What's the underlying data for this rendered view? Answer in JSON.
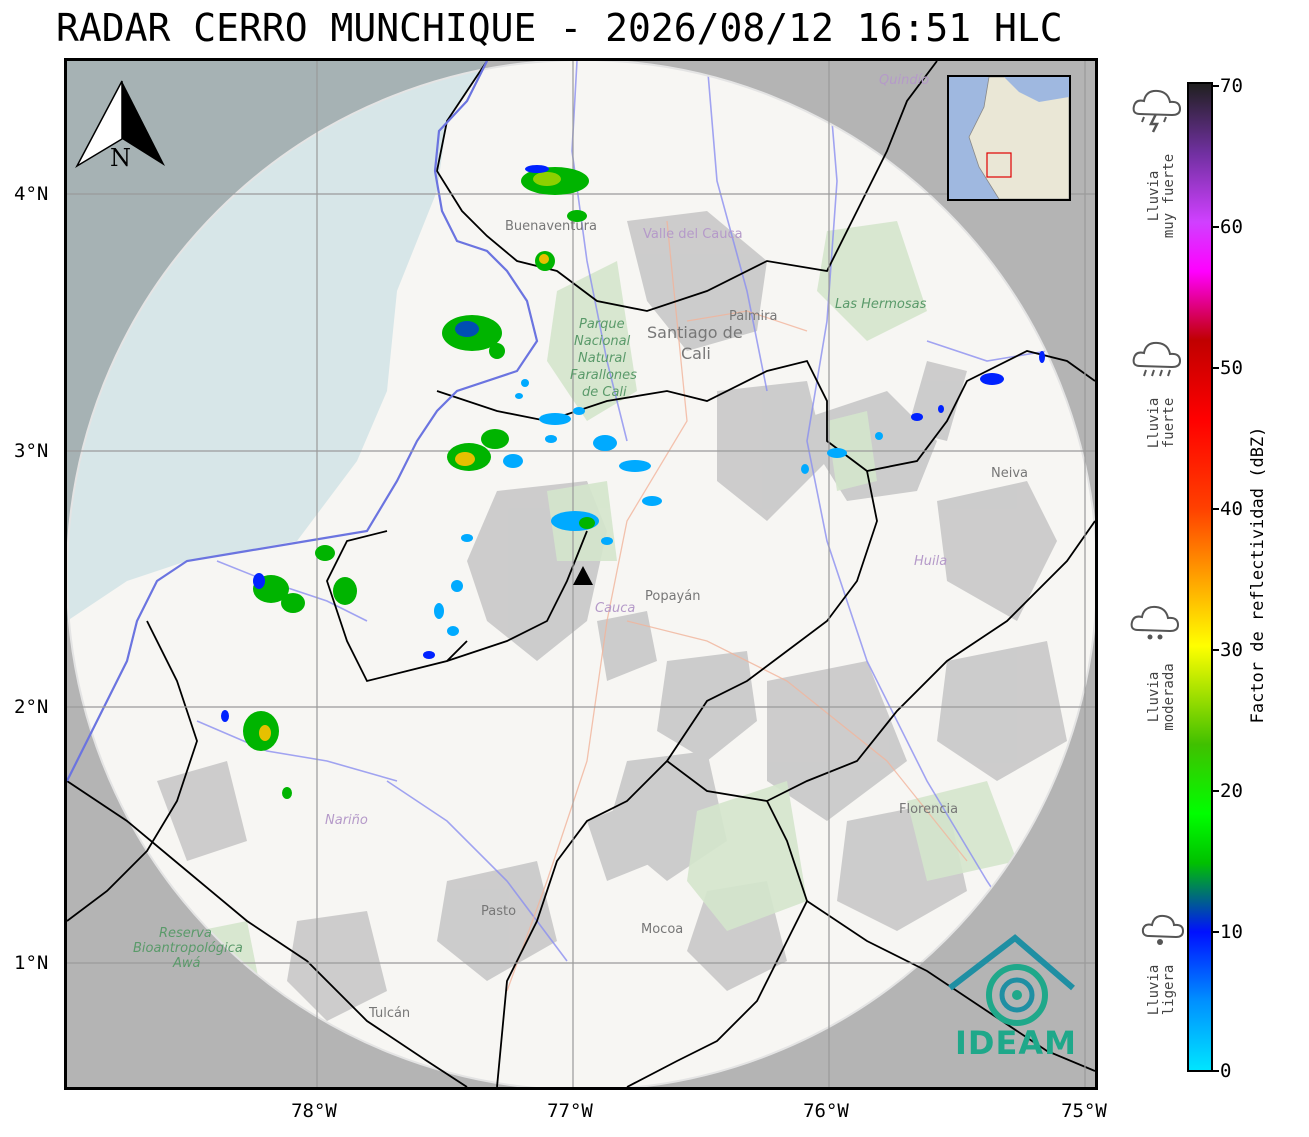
{
  "title": "RADAR CERRO MUNCHIQUE - 2026/08/12 16:51 HLC",
  "axes": {
    "x_ticks": [
      "78°W",
      "77°W",
      "76°W",
      "75°W"
    ],
    "y_ticks": [
      "4°N",
      "3°N",
      "2°N",
      "1°N"
    ]
  },
  "north_arrow": {
    "label": "N"
  },
  "colorbar": {
    "title": "Factor de reflectividad (dBZ)",
    "ticks": [
      "70",
      "60",
      "50",
      "40",
      "30",
      "20",
      "10",
      "0"
    ],
    "range": [
      0,
      70
    ]
  },
  "rain_categories": [
    {
      "line1": "Lluvia",
      "line2": "muy fuerte",
      "icon": "cloud-storm-icon"
    },
    {
      "line1": "Lluvia",
      "line2": "fuerte",
      "icon": "cloud-heavy-rain-icon"
    },
    {
      "line1": "Lluvia",
      "line2": "moderada",
      "icon": "cloud-moderate-rain-icon"
    },
    {
      "line1": "Lluvia",
      "line2": "ligera",
      "icon": "cloud-light-rain-icon"
    }
  ],
  "places": [
    {
      "name": "Santiago de",
      "color": "#777777"
    },
    {
      "name": "Cali",
      "color": "#777777"
    },
    {
      "name": "Palmira",
      "color": "#777777"
    },
    {
      "name": "Buenaventura",
      "color": "#777777"
    },
    {
      "name": "Valle del Cauca",
      "color": "#b59ac9"
    },
    {
      "name": "Parque",
      "color": "#5a9a6a"
    },
    {
      "name": "Nacional",
      "color": "#5a9a6a"
    },
    {
      "name": "Natural",
      "color": "#5a9a6a"
    },
    {
      "name": "Farallones",
      "color": "#5a9a6a"
    },
    {
      "name": "de Cali",
      "color": "#5a9a6a"
    },
    {
      "name": "Las Hermosas",
      "color": "#5a9a6a"
    },
    {
      "name": "Quindío",
      "color": "#b59ac9"
    },
    {
      "name": "Neiva",
      "color": "#777777"
    },
    {
      "name": "Huila",
      "color": "#b59ac9"
    },
    {
      "name": "Cauca",
      "color": "#b59ac9"
    },
    {
      "name": "Popayán",
      "color": "#777777"
    },
    {
      "name": "Nariño",
      "color": "#b59ac9"
    },
    {
      "name": "Pasto",
      "color": "#777777"
    },
    {
      "name": "Mocoa",
      "color": "#777777"
    },
    {
      "name": "Florencia",
      "color": "#777777"
    },
    {
      "name": "Tulcán",
      "color": "#777777"
    },
    {
      "name": "Reserva",
      "color": "#5a9a6a"
    },
    {
      "name": "Bioantropológica",
      "color": "#5a9a6a"
    },
    {
      "name": "Awá",
      "color": "#5a9a6a"
    }
  ],
  "logo": {
    "text": "IDEAM",
    "color": "#1fa88a"
  },
  "colors": {
    "radar_range_fill": "#f7f6f3",
    "outside_range": "#b4b4b4",
    "ocean": "#aad3df"
  }
}
